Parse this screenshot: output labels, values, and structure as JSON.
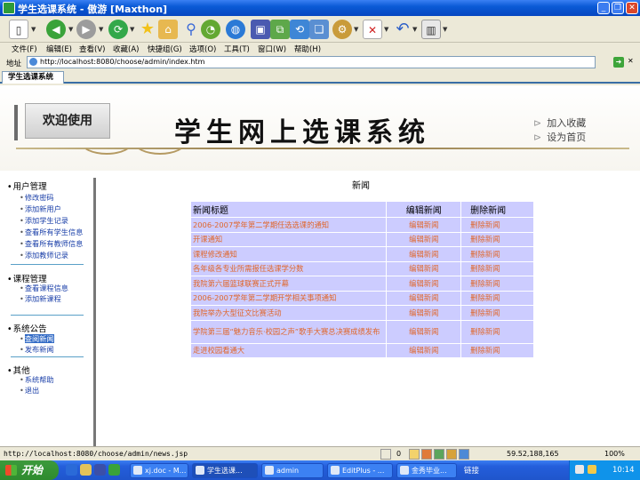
{
  "window": {
    "title": "学生选课系统 - 傲游 [Maxthon]"
  },
  "menu": [
    "文件(F)",
    "编辑(E)",
    "查看(V)",
    "收藏(A)",
    "快捷组(G)",
    "选项(O)",
    "工具(T)",
    "窗口(W)",
    "帮助(H)"
  ],
  "address": {
    "label": "地址",
    "url": "http://localhost:8080/choose/admin/index.htm"
  },
  "tab": {
    "label": "学生选课系统"
  },
  "banner": {
    "welcome": "欢迎使用",
    "title": "学生网上选课系统",
    "link_favorite": "加入收藏",
    "link_home": "设为首页"
  },
  "sidebar": {
    "sections": [
      {
        "title": "用户管理",
        "items": [
          "修改密码",
          "添加新用户",
          "添加学生记录",
          "查看所有学生信息",
          "查看所有教师信息",
          "添加教师记录"
        ]
      },
      {
        "title": "课程管理",
        "items": [
          "查看课程信息",
          "添加新课程"
        ]
      },
      {
        "title": "系统公告",
        "items": [
          "查阅新闻",
          "发布新闻"
        ],
        "current_item": "查阅新闻"
      },
      {
        "title": "其他",
        "items": [
          "系统帮助",
          "退出"
        ]
      }
    ]
  },
  "news": {
    "heading": "新闻",
    "headers": [
      "新闻标题",
      "编辑新闻",
      "删除新闻"
    ],
    "edit_label": "编辑新闻",
    "delete_label": "删除新闻",
    "rows": [
      "2006-2007学年第二学期任选选课的通知",
      "开课通知",
      "课程修改通知",
      "各年级各专业所需报任选课学分数",
      "我院第六届篮球联赛正式开幕",
      "2006-2007学年第二学期开学相关事项通知",
      "我院举办大型征文比赛活动",
      "学院第三届“魅力音乐·校园之声”歌手大赛总决赛成绩发布",
      "走进校园看通大"
    ]
  },
  "status": {
    "url": "http://localhost:8080/choose/admin/news.jsp",
    "count": "0",
    "speed": "59.52,188,165",
    "zoom": "100%"
  },
  "taskbar": {
    "start": "开始",
    "tasks": [
      "xj.doc - M...",
      "学生选课...",
      "admin",
      "EditPlus - ...",
      "金秀毕业..."
    ],
    "links_label": "链接",
    "clock": "10:14"
  },
  "colors": {
    "news_link": "#e0662a",
    "table_bg": "#ccccff",
    "sidebar_link": "#1a3fa8",
    "taskbar": "#245edb"
  }
}
